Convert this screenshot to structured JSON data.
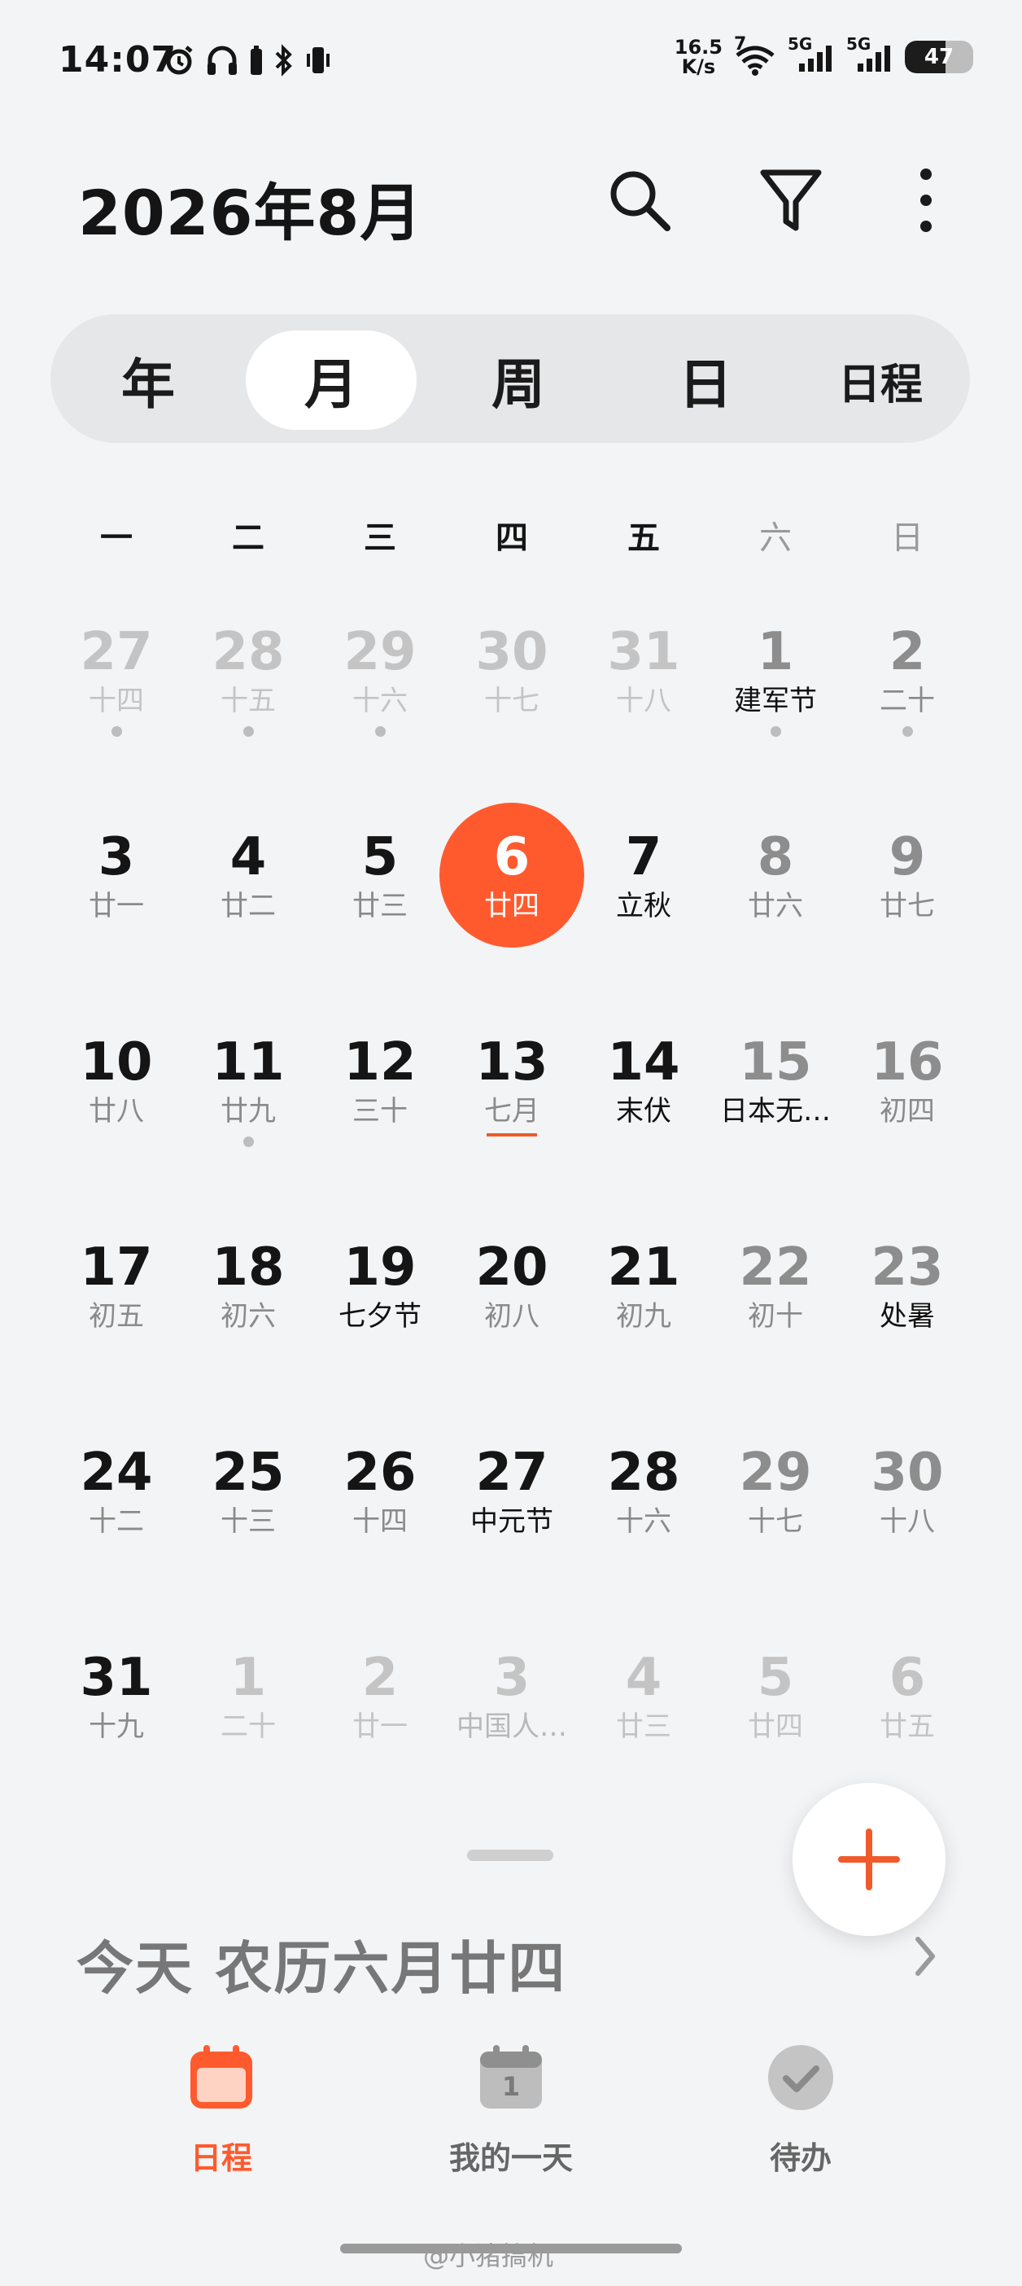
{
  "status_bar": {
    "time": "14:07",
    "net_speed_value": "16.5",
    "net_speed_unit": "K/s",
    "wifi_badge": "7",
    "sim1_label": "5G",
    "sim2_label": "5G",
    "battery_level": "47"
  },
  "header": {
    "title": "2026年8月",
    "icons": [
      "search-icon",
      "filter-icon",
      "more-vert-icon"
    ]
  },
  "view_tabs": [
    {
      "label": "年",
      "active": false
    },
    {
      "label": "月",
      "active": true
    },
    {
      "label": "周",
      "active": false
    },
    {
      "label": "日",
      "active": false
    },
    {
      "label": "日程",
      "active": false
    }
  ],
  "weekdays": [
    "一",
    "二",
    "三",
    "四",
    "五",
    "六",
    "日"
  ],
  "calendar": {
    "weeks": [
      [
        {
          "day": "27",
          "sub": "十四",
          "muted": true,
          "dot": true
        },
        {
          "day": "28",
          "sub": "十五",
          "muted": true,
          "dot": true
        },
        {
          "day": "29",
          "sub": "十六",
          "muted": true,
          "dot": true
        },
        {
          "day": "30",
          "sub": "十七",
          "muted": true
        },
        {
          "day": "31",
          "sub": "十八",
          "muted": true
        },
        {
          "day": "1",
          "sub": "建军节",
          "festival": true,
          "dot": true
        },
        {
          "day": "2",
          "sub": "二十",
          "dot": true
        }
      ],
      [
        {
          "day": "3",
          "sub": "廿一"
        },
        {
          "day": "4",
          "sub": "廿二"
        },
        {
          "day": "5",
          "sub": "廿三"
        },
        {
          "day": "6",
          "sub": "廿四",
          "today": true
        },
        {
          "day": "7",
          "sub": "立秋",
          "festival": true
        },
        {
          "day": "8",
          "sub": "廿六"
        },
        {
          "day": "9",
          "sub": "廿七"
        }
      ],
      [
        {
          "day": "10",
          "sub": "廿八"
        },
        {
          "day": "11",
          "sub": "廿九",
          "dot": true
        },
        {
          "day": "12",
          "sub": "三十"
        },
        {
          "day": "13",
          "sub": "七月",
          "underline": true
        },
        {
          "day": "14",
          "sub": "末伏",
          "festival": true
        },
        {
          "day": "15",
          "sub": "日本无…",
          "festival": true
        },
        {
          "day": "16",
          "sub": "初四"
        }
      ],
      [
        {
          "day": "17",
          "sub": "初五"
        },
        {
          "day": "18",
          "sub": "初六"
        },
        {
          "day": "19",
          "sub": "七夕节",
          "festival": true
        },
        {
          "day": "20",
          "sub": "初八"
        },
        {
          "day": "21",
          "sub": "初九"
        },
        {
          "day": "22",
          "sub": "初十"
        },
        {
          "day": "23",
          "sub": "处暑",
          "festival": true
        }
      ],
      [
        {
          "day": "24",
          "sub": "十二"
        },
        {
          "day": "25",
          "sub": "十三"
        },
        {
          "day": "26",
          "sub": "十四"
        },
        {
          "day": "27",
          "sub": "中元节",
          "festival": true
        },
        {
          "day": "28",
          "sub": "十六"
        },
        {
          "day": "29",
          "sub": "十七"
        },
        {
          "day": "30",
          "sub": "十八"
        }
      ],
      [
        {
          "day": "31",
          "sub": "十九"
        },
        {
          "day": "1",
          "sub": "二十",
          "muted": true
        },
        {
          "day": "2",
          "sub": "廿一",
          "muted": true
        },
        {
          "day": "3",
          "sub": "中国人…",
          "muted": true,
          "festival": true
        },
        {
          "day": "4",
          "sub": "廿三",
          "muted": true
        },
        {
          "day": "5",
          "sub": "廿四",
          "muted": true
        },
        {
          "day": "6",
          "sub": "廿五",
          "muted": true
        }
      ]
    ]
  },
  "today_info": {
    "text": "今天 农历六月廿四"
  },
  "bottom_nav": [
    {
      "label": "日程",
      "icon": "calendar-icon",
      "active": true
    },
    {
      "label": "我的一天",
      "icon": "my-day-calendar-icon",
      "badge": "1",
      "active": false
    },
    {
      "label": "待办",
      "icon": "todo-check-icon",
      "active": false
    }
  ],
  "watermark": "@小猪搞机",
  "colors": {
    "accent": "#ff5a2e",
    "background": "#f3f4f6"
  }
}
